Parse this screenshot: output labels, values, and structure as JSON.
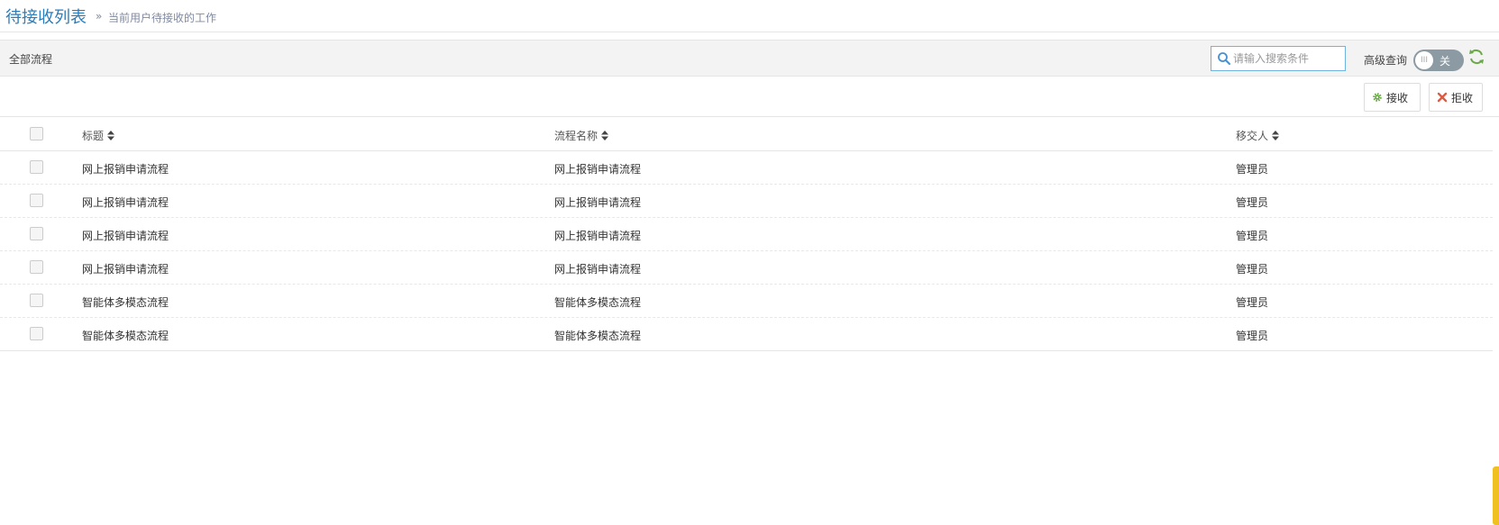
{
  "header": {
    "title": "待接收列表",
    "separator": "»",
    "subtitle": "当前用户待接收的工作"
  },
  "toolbar": {
    "filter_label": "全部流程",
    "search_placeholder": "请输入搜索条件",
    "search_value": "",
    "advanced_label": "高级查询",
    "toggle_state": "关",
    "toggle_knob": "III"
  },
  "actions": {
    "accept_label": "接收",
    "reject_label": "拒收"
  },
  "table": {
    "columns": [
      "标题",
      "流程名称",
      "移交人"
    ],
    "rows": [
      [
        "网上报销申请流程",
        "网上报销申请流程",
        "管理员"
      ],
      [
        "网上报销申请流程",
        "网上报销申请流程",
        "管理员"
      ],
      [
        "网上报销申请流程",
        "网上报销申请流程",
        "管理员"
      ],
      [
        "网上报销申请流程",
        "网上报销申请流程",
        "管理员"
      ],
      [
        "智能体多模态流程",
        "智能体多模态流程",
        "管理员"
      ],
      [
        "智能体多模态流程",
        "智能体多模态流程",
        "管理员"
      ]
    ]
  },
  "colors": {
    "title": "#2b7dbc",
    "toolbar_bg": "#f3f3f3",
    "accept_icon": "#69aa46",
    "reject_icon": "#dd5a43",
    "refresh_icon": "#69aa46",
    "toggle_bg": "#8b9aa3"
  }
}
